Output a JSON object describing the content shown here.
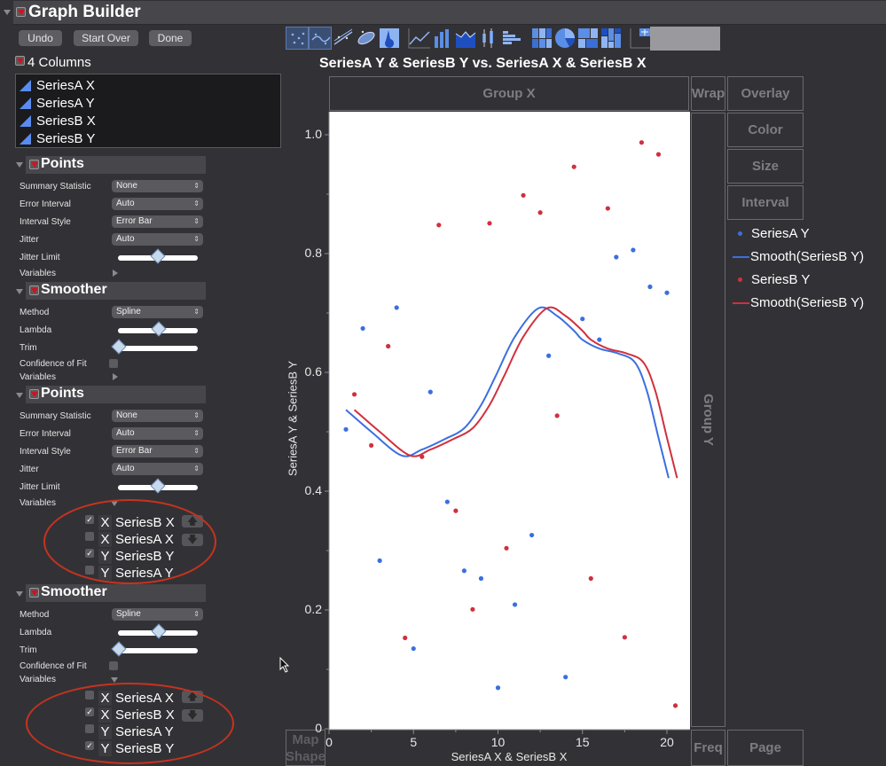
{
  "app": {
    "title": "Graph Builder"
  },
  "buttons": {
    "undo": "Undo",
    "start_over": "Start Over",
    "done": "Done"
  },
  "toolbar": {
    "element_icons": [
      "points-icon",
      "smoother-icon",
      "line-of-fit-icon",
      "ellipse-icon",
      "contour-icon",
      "line-icon",
      "bar-icon",
      "area-icon",
      "box-plot-icon",
      "histogram-icon",
      "heatmap-icon",
      "pie-icon",
      "treemap-icon",
      "mosaic-icon",
      "caption-box-icon",
      "formula-icon",
      "map-shapes-icon",
      "parallel-icon"
    ],
    "selected": [
      "points-icon",
      "smoother-icon"
    ]
  },
  "columns": {
    "label": "4 Columns",
    "items": [
      "SeriesA X",
      "SeriesA Y",
      "SeriesB X",
      "SeriesB Y"
    ]
  },
  "panels": [
    {
      "title": "Points",
      "rows": [
        {
          "label": "Summary Statistic",
          "value": "None"
        },
        {
          "label": "Error Interval",
          "value": "Auto"
        },
        {
          "label": "Interval Style",
          "value": "Error Bar"
        },
        {
          "label": "Jitter",
          "value": "Auto"
        }
      ],
      "jitter_limit_label": "Jitter Limit",
      "jitter_limit": 0.5,
      "variables_label": "Variables"
    },
    {
      "title": "Smoother",
      "method_label": "Method",
      "method": "Spline",
      "lambda_label": "Lambda",
      "lambda": 0.5,
      "trim_label": "Trim",
      "trim": 0.0,
      "cof_label": "Confidence of Fit",
      "cof": false,
      "variables_label": "Variables"
    },
    {
      "title": "Points",
      "rows": [
        {
          "label": "Summary Statistic",
          "value": "None"
        },
        {
          "label": "Error Interval",
          "value": "Auto"
        },
        {
          "label": "Interval Style",
          "value": "Error Bar"
        },
        {
          "label": "Jitter",
          "value": "Auto"
        }
      ],
      "jitter_limit_label": "Jitter Limit",
      "jitter_limit": 0.5,
      "variables_label": "Variables",
      "variables": [
        {
          "role": "X",
          "name": "SeriesB X",
          "checked": true
        },
        {
          "role": "X",
          "name": "SeriesA X",
          "checked": false
        },
        {
          "role": "Y",
          "name": "SeriesB Y",
          "checked": true
        },
        {
          "role": "Y",
          "name": "SeriesA Y",
          "checked": false
        }
      ]
    },
    {
      "title": "Smoother",
      "method_label": "Method",
      "method": "Spline",
      "lambda_label": "Lambda",
      "lambda": 0.5,
      "trim_label": "Trim",
      "trim": 0.0,
      "cof_label": "Confidence of Fit",
      "cof": false,
      "variables_label": "Variables",
      "variables": [
        {
          "role": "X",
          "name": "SeriesA X",
          "checked": false
        },
        {
          "role": "X",
          "name": "SeriesB X",
          "checked": true
        },
        {
          "role": "Y",
          "name": "SeriesA Y",
          "checked": false
        },
        {
          "role": "Y",
          "name": "SeriesB Y",
          "checked": true
        }
      ]
    }
  ],
  "zones": {
    "group_x": "Group X",
    "group_y": "Group Y",
    "wrap": "Wrap",
    "overlay": "Overlay",
    "color": "Color",
    "size": "Size",
    "interval": "Interval",
    "freq": "Freq",
    "page": "Page",
    "map_shape": "Map Shape"
  },
  "legend": [
    {
      "type": "point",
      "label": "SeriesA Y",
      "color": "#3a6fe0"
    },
    {
      "type": "line",
      "label": "Smooth(SeriesB Y)",
      "color": "#3a6fe0"
    },
    {
      "type": "point",
      "label": "SeriesB Y",
      "color": "#d0303e"
    },
    {
      "type": "line",
      "label": "Smooth(SeriesB Y)",
      "color": "#d0303e"
    }
  ],
  "colors": {
    "seriesA": "#3a6fe0",
    "seriesB": "#d0303e",
    "annotation": "#c8321e"
  },
  "chart_data": {
    "type": "scatter",
    "title": "SeriesA Y & SeriesB Y vs. SeriesA X & SeriesB X",
    "xlabel": "SeriesA X & SeriesB X",
    "ylabel": "SeriesA Y & SeriesB Y",
    "xlim": [
      0,
      21.2
    ],
    "ylim": [
      0,
      1.04
    ],
    "xticks": [
      0,
      5,
      10,
      15,
      20
    ],
    "xtick_labels": [
      "0",
      "5",
      "10",
      "15",
      "20"
    ],
    "yticks": [
      0,
      0.2,
      0.4,
      0.6,
      0.8,
      1.0
    ],
    "ytick_labels": [
      "0",
      "0.2",
      "0.4",
      "0.6",
      "0.8",
      "1.0"
    ],
    "grid": false,
    "legend_position": "right",
    "series": [
      {
        "name": "SeriesA Y",
        "kind": "points",
        "color": "#3a6fe0",
        "x": [
          1,
          2,
          3,
          4,
          5,
          6,
          7,
          8,
          9,
          10,
          11,
          12,
          13,
          14,
          15,
          16,
          17,
          18,
          19,
          20
        ],
        "y": [
          0.504,
          0.674,
          0.283,
          0.709,
          0.135,
          0.567,
          0.382,
          0.266,
          0.253,
          0.069,
          0.209,
          0.326,
          0.628,
          0.087,
          0.69,
          0.655,
          0.794,
          0.806,
          0.744,
          0.734
        ]
      },
      {
        "name": "Smooth(SeriesB Y)",
        "kind": "line",
        "color": "#3a6fe0",
        "x": [
          1.0,
          2.5,
          4.3,
          5.5,
          6.8,
          8.0,
          9.0,
          9.9,
          11.0,
          12.4,
          13.5,
          14.5,
          15.0,
          16.0,
          17.1,
          18.1,
          18.8,
          19.5,
          20.1
        ],
        "y": [
          0.537,
          0.5,
          0.46,
          0.47,
          0.487,
          0.506,
          0.545,
          0.596,
          0.66,
          0.708,
          0.695,
          0.67,
          0.655,
          0.64,
          0.632,
          0.617,
          0.57,
          0.49,
          0.422
        ]
      },
      {
        "name": "SeriesB Y",
        "kind": "points",
        "color": "#d0303e",
        "x": [
          1.5,
          2.5,
          3.5,
          4.5,
          5.5,
          6.5,
          7.5,
          8.5,
          9.5,
          10.5,
          11.5,
          12.5,
          13.5,
          14.5,
          15.5,
          16.5,
          17.5,
          18.5,
          19.5,
          20.5
        ],
        "y": [
          0.563,
          0.477,
          0.644,
          0.153,
          0.458,
          0.848,
          0.367,
          0.201,
          0.851,
          0.304,
          0.898,
          0.869,
          0.527,
          0.946,
          0.253,
          0.876,
          0.154,
          0.987,
          0.967,
          0.039
        ]
      },
      {
        "name": "Smooth(SeriesB Y)",
        "kind": "line",
        "color": "#d0303e",
        "x": [
          1.5,
          3.0,
          4.8,
          6.0,
          7.3,
          8.5,
          9.5,
          10.4,
          11.5,
          12.9,
          14.0,
          15.0,
          15.5,
          16.5,
          17.6,
          18.6,
          19.3,
          20.0,
          20.6
        ],
        "y": [
          0.537,
          0.5,
          0.46,
          0.47,
          0.487,
          0.506,
          0.545,
          0.596,
          0.66,
          0.708,
          0.695,
          0.67,
          0.655,
          0.64,
          0.632,
          0.617,
          0.57,
          0.49,
          0.422
        ]
      }
    ]
  }
}
